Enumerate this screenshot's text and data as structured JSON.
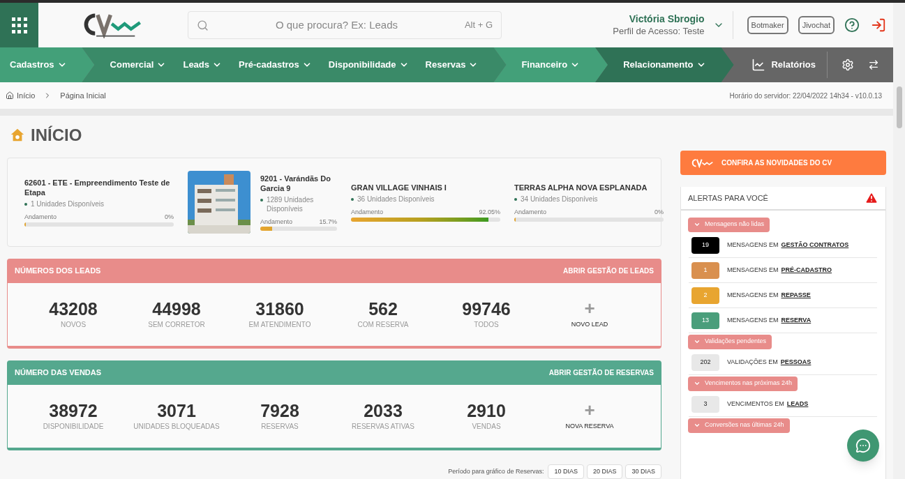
{
  "header": {
    "search": {
      "placeholder": "O que procura? Ex: Leads",
      "shortcut": "Alt + G"
    },
    "user": {
      "name": "Victória Sbrogio",
      "profile": "Perfil de Acesso: Teste"
    },
    "buttons": [
      "Botmaker",
      "Jivochat"
    ]
  },
  "nav": {
    "items": [
      {
        "label": "Cadastros",
        "color": "#43a079"
      },
      {
        "label": "Comercial",
        "color": "#3a8a68"
      },
      {
        "label": "Leads",
        "color": "#3a8a68"
      },
      {
        "label": "Pré-cadastros",
        "color": "#3a8a68"
      },
      {
        "label": "Disponibilidade",
        "color": "#3a8a68"
      },
      {
        "label": "Reservas",
        "color": "#3a8a68"
      },
      {
        "label": "Financeiro",
        "color": "#43a079"
      },
      {
        "label": "Relacionamento",
        "color": "#2f7256"
      }
    ],
    "reports": "Relatórios"
  },
  "breadcrumb": [
    "Início",
    "Página Inicial"
  ],
  "server_time": "Horário do servidor: 22/04/2022 14h34 - v10.0.13",
  "page_title": "INÍCIO",
  "projects": [
    {
      "name": "62601 - ETE - Empreendimento Teste de Etapa",
      "units": "1 Unidades Disponíveis",
      "progress_label": "Andamento",
      "percent": "0%",
      "level": 0,
      "kind": "text"
    },
    {
      "name": "9201 - Varándãs Do Garcia 9",
      "units": "1289 Unidades Disponíveis",
      "progress_label": "Andamento",
      "percent": "15.7%",
      "level": 0.157,
      "kind": "picture"
    },
    {
      "name": "GRAN VILLAGE VINHAIS I",
      "units": "36 Unidades Disponíveis",
      "progress_label": "Andamento",
      "percent": "92.05%",
      "level": 0.9205,
      "kind": "text"
    },
    {
      "name": "TERRAS ALPHA NOVA ESPLANADA",
      "units": "34 Unidades Disponíveis",
      "progress_label": "Andamento",
      "percent": "0%",
      "level": 0,
      "kind": "text"
    }
  ],
  "panels": [
    {
      "title": "NÚMEROS DOS LEADS",
      "link": "ABRIR GESTÃO DE LEADS",
      "color": "#e88c8a",
      "stats": [
        {
          "value": "43208",
          "label": "NOVOS"
        },
        {
          "value": "44998",
          "label": "SEM CORRETOR"
        },
        {
          "value": "31860",
          "label": "EM ATENDIMENTO"
        },
        {
          "value": "562",
          "label": "COM RESERVA"
        },
        {
          "value": "99746",
          "label": "TODOS"
        }
      ],
      "add": {
        "symbol": "+",
        "label": "NOVO LEAD"
      }
    },
    {
      "title": "NÚMERO DAS VENDAS",
      "link": "ABRIR GESTÃO DE RESERVAS",
      "color": "#55a88e",
      "stats": [
        {
          "value": "38972",
          "label": "DISPONIBILIDADE"
        },
        {
          "value": "3071",
          "label": "UNIDADES BLOQUEADAS"
        },
        {
          "value": "7928",
          "label": "RESERVAS"
        },
        {
          "value": "2033",
          "label": "RESERVAS ATIVAS"
        },
        {
          "value": "2910",
          "label": "VENDAS"
        }
      ],
      "add": {
        "symbol": "+",
        "label": "NOVA RESERVA"
      }
    }
  ],
  "period": {
    "label": "Período para gráfico de Reservas:",
    "buttons": [
      "10 DIAS",
      "20 DIAS",
      "30 DIAS"
    ]
  },
  "news_button": "CONFIRA AS NOVIDADES DO CV",
  "alerts": {
    "title": "ALERTAS PARA VOCÊ",
    "groups": [
      {
        "title": "Mensagens não lidas",
        "items": [
          {
            "count": "19",
            "color": "#000000",
            "text": "MENSAGENS EM",
            "link": "GESTÃO CONTRATOS"
          },
          {
            "count": "1",
            "color": "#d9904f",
            "text": "MENSAGENS EM",
            "link": "PRÉ-CADASTRO"
          },
          {
            "count": "2",
            "color": "#e8a530",
            "text": "MENSAGENS EM",
            "link": "REPASSE"
          },
          {
            "count": "13",
            "color": "#4a9e7b",
            "text": "MENSAGENS EM",
            "link": "RESERVA"
          }
        ]
      },
      {
        "title": "Validações pendentes",
        "items": [
          {
            "count": "202",
            "color": "#e8e8e8",
            "text": "VALIDAÇÕES EM",
            "link": "PESSOAS"
          }
        ]
      },
      {
        "title": "Vencimentos nas próximas 24h",
        "items": [
          {
            "count": "3",
            "color": "#e8e8e8",
            "text": "VENCIMENTOS EM",
            "link": "LEADS"
          }
        ]
      },
      {
        "title": "Conversões nas últimas 24h"
      }
    ]
  }
}
